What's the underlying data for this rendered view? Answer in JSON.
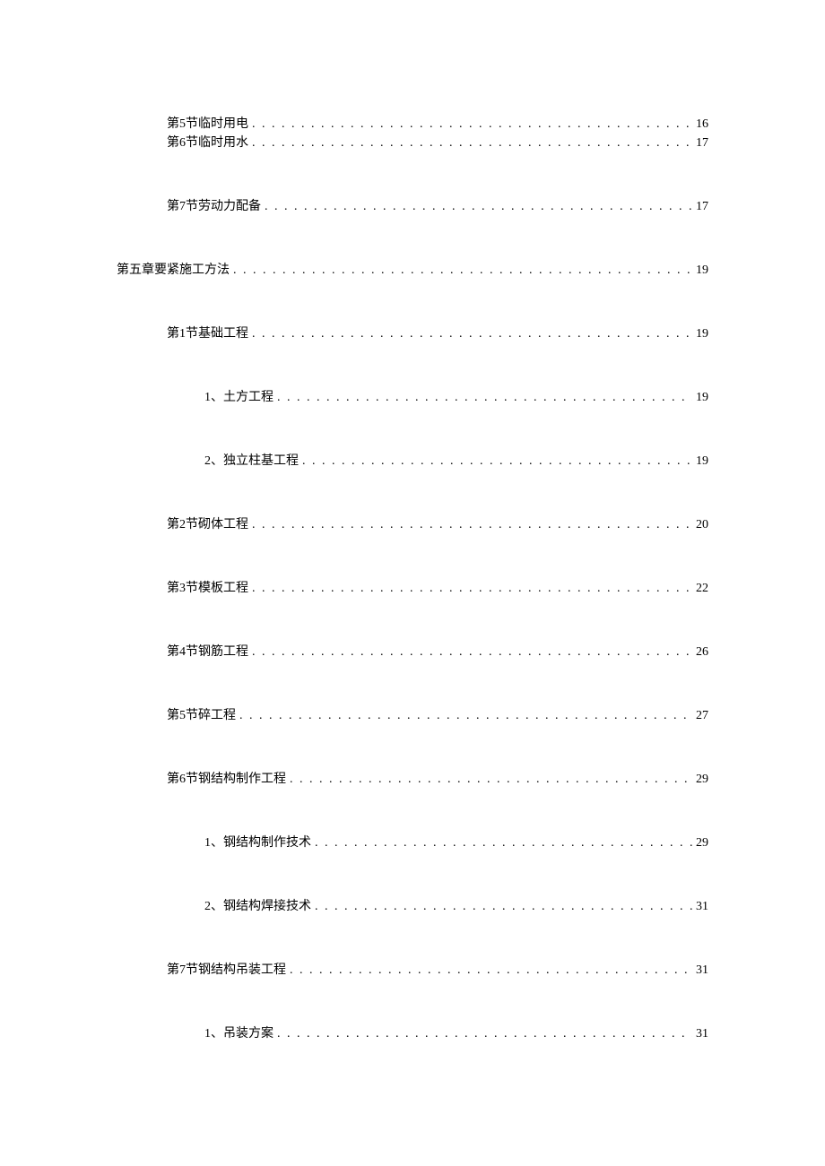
{
  "toc": [
    {
      "label": "第5节临时用电",
      "page": "16",
      "level": 1,
      "gap": "none"
    },
    {
      "label": "第6节临时用水",
      "page": "17",
      "level": 1,
      "gap": "big"
    },
    {
      "label": "第7节劳动力配备",
      "page": "17",
      "level": 1,
      "gap": "big"
    },
    {
      "label": "第五章要紧施工方法",
      "page": "19",
      "level": 0,
      "gap": "big"
    },
    {
      "label": "第1节基础工程",
      "page": "19",
      "level": 1,
      "gap": "big"
    },
    {
      "label": "1、土方工程",
      "page": "19",
      "level": 2,
      "gap": "big"
    },
    {
      "label": "2、独立柱基工程",
      "page": "19",
      "level": 2,
      "gap": "big"
    },
    {
      "label": "第2节砌体工程",
      "page": "20",
      "level": 1,
      "gap": "big"
    },
    {
      "label": "第3节模板工程",
      "page": "22",
      "level": 1,
      "gap": "big"
    },
    {
      "label": "第4节钢筋工程",
      "page": "26",
      "level": 1,
      "gap": "big"
    },
    {
      "label": "第5节碎工程",
      "page": "27",
      "level": 1,
      "gap": "big"
    },
    {
      "label": "第6节钢结构制作工程",
      "page": "29",
      "level": 1,
      "gap": "big"
    },
    {
      "label": "1、钢结构制作技术",
      "page": "29",
      "level": 2,
      "gap": "big"
    },
    {
      "label": "2、钢结构焊接技术",
      "page": "31",
      "level": 2,
      "gap": "big"
    },
    {
      "label": "第7节钢结构吊装工程",
      "page": "31",
      "level": 1,
      "gap": "big"
    },
    {
      "label": "1、吊装方案",
      "page": "31",
      "level": 2,
      "gap": "none"
    }
  ]
}
